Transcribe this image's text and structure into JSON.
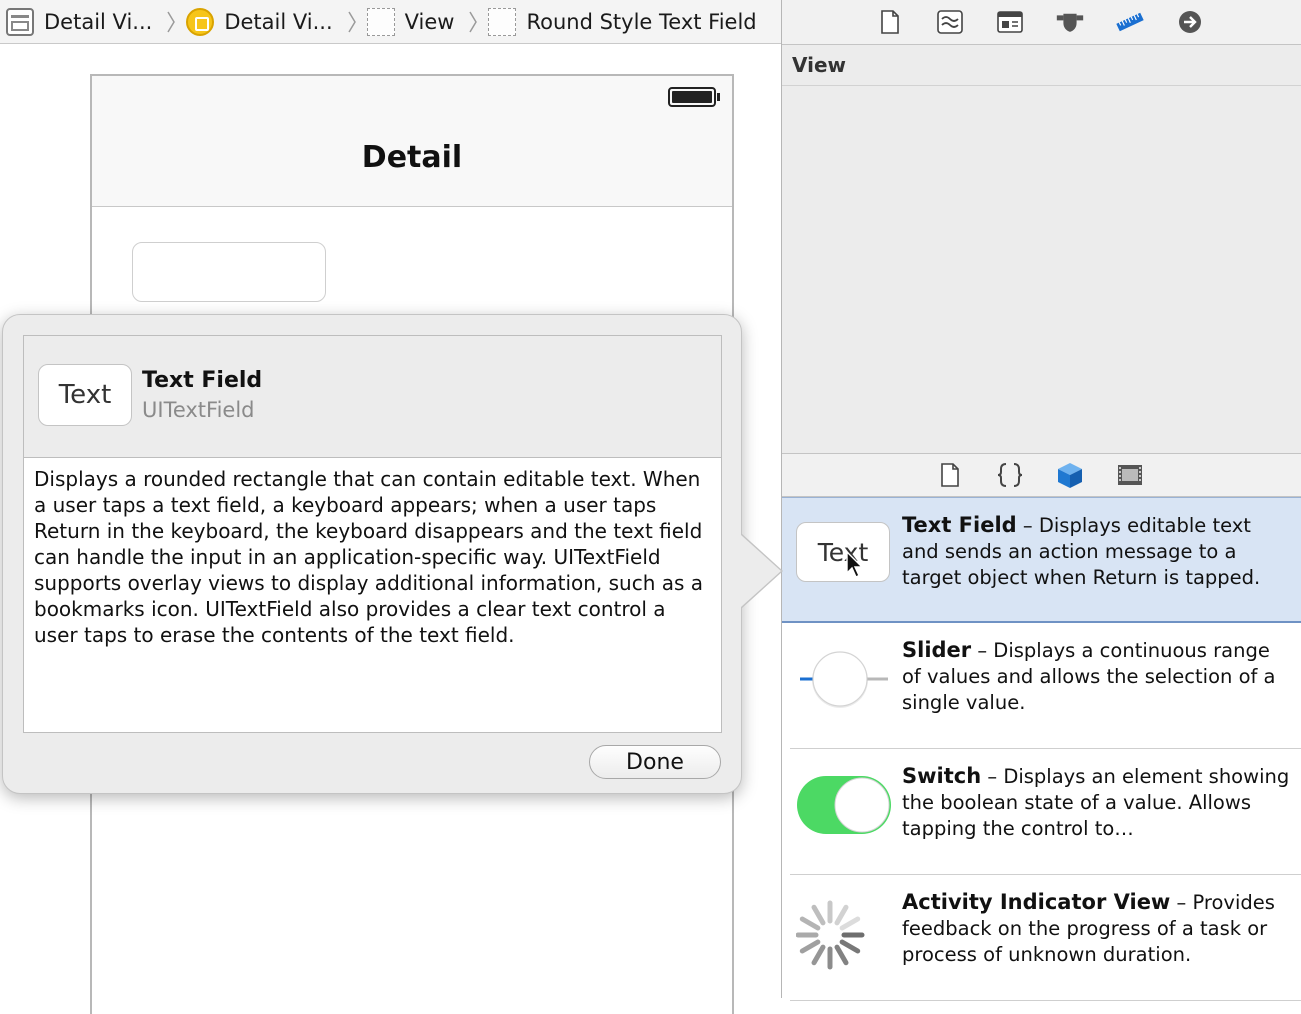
{
  "breadcrumb": {
    "items": [
      {
        "label": "Detail Vi...",
        "icon": "storyboard-icon"
      },
      {
        "label": "Detail Vi...",
        "icon": "view-controller-icon"
      },
      {
        "label": "View",
        "icon": "view-icon"
      },
      {
        "label": "Round Style Text Field",
        "icon": "view-icon"
      }
    ]
  },
  "canvas": {
    "nav_title": "Detail"
  },
  "popover": {
    "object_icon_text": "Text",
    "title": "Text Field",
    "class_name": "UITextField",
    "description": "Displays a rounded rectangle that can contain editable text. When a user taps a text field, a keyboard appears; when a user taps Return in the keyboard, the keyboard disappears and the text field can handle the input in an application-specific way. UITextField supports overlay views to display additional information, such as a bookmarks icon. UITextField also provides a clear text control a user taps to erase the contents of the text field.",
    "done_label": "Done"
  },
  "utilities": {
    "inspector_tabs": [
      "file-inspector-icon",
      "quick-help-icon",
      "identity-inspector-icon",
      "attributes-inspector-icon",
      "size-inspector-icon",
      "connections-inspector-icon"
    ],
    "selected_inspector": "size-inspector-icon",
    "section_title": "View",
    "library_tabs": [
      "file-template-icon",
      "code-snippet-icon",
      "object-library-icon",
      "media-library-icon"
    ],
    "selected_library": "object-library-icon",
    "library_items": [
      {
        "title": "Text Field",
        "desc": " – Displays editable text and sends an action message to a target object when Return is tapped.",
        "icon": "text-field-icon",
        "icon_text": "Text",
        "selected": true
      },
      {
        "title": "Slider",
        "desc": " – Displays a continuous range of values and allows the selection of a single value.",
        "icon": "slider-icon",
        "selected": false
      },
      {
        "title": "Switch",
        "desc": " – Displays an element showing the boolean state of a value. Allows tapping the control to…",
        "icon": "switch-icon",
        "selected": false
      },
      {
        "title": "Activity Indicator View",
        "desc": " – Provides feedback on the progress of a task or process of unknown duration.",
        "icon": "activity-indicator-icon",
        "selected": false
      }
    ]
  },
  "colors": {
    "accent_blue": "#1a6fd1",
    "switch_green": "#4cd964",
    "selection_bg": "#d8e4f4"
  }
}
